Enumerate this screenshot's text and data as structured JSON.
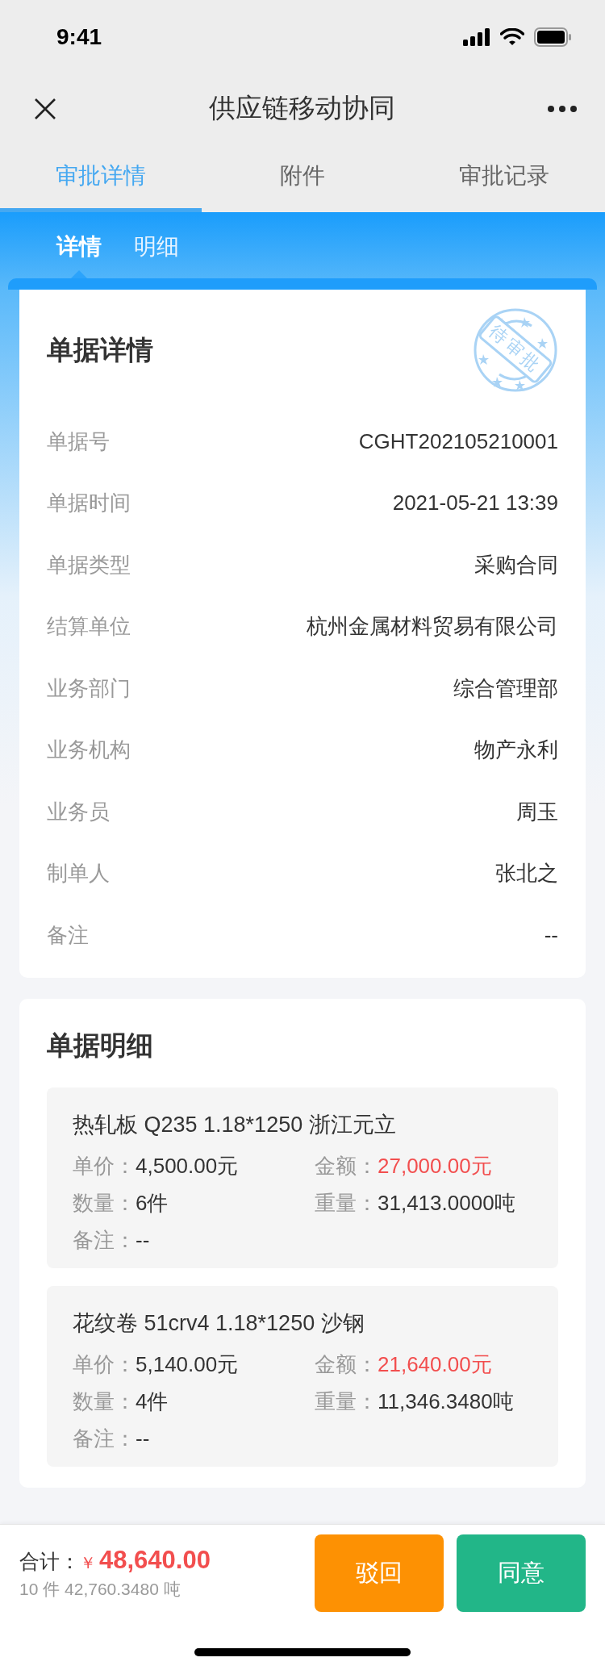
{
  "status_bar": {
    "time": "9:41"
  },
  "nav": {
    "title": "供应链移动协同"
  },
  "tabs": [
    {
      "label": "审批详情",
      "selected": true
    },
    {
      "label": "附件",
      "selected": false
    },
    {
      "label": "审批记录",
      "selected": false
    }
  ],
  "sub_tabs": [
    {
      "label": "详情",
      "selected": true
    },
    {
      "label": "明细",
      "selected": false
    }
  ],
  "detail": {
    "title": "单据详情",
    "stamp": "待审批",
    "fields": [
      {
        "label": "单据号",
        "value": "CGHT202105210001"
      },
      {
        "label": "单据时间",
        "value": "2021-05-21 13:39"
      },
      {
        "label": "单据类型",
        "value": "采购合同"
      },
      {
        "label": "结算单位",
        "value": "杭州金属材料贸易有限公司"
      },
      {
        "label": "业务部门",
        "value": "综合管理部"
      },
      {
        "label": "业务机构",
        "value": "物产永利"
      },
      {
        "label": "业务员",
        "value": "周玉"
      },
      {
        "label": "制单人",
        "value": "张北之"
      },
      {
        "label": "备注",
        "value": "--"
      }
    ]
  },
  "lines": {
    "title": "单据明细",
    "items": [
      {
        "name": "热轧板 Q235 1.18*1250 浙江元立",
        "price_label": "单价：",
        "price": "4,500.00元",
        "amount_label": "金额：",
        "amount": "27,000.00元",
        "qty_label": "数量：",
        "qty": "6件",
        "weight_label": "重量：",
        "weight": "31,413.0000吨",
        "note_label": "备注：",
        "note": "--"
      },
      {
        "name": "花纹卷 51crv4 1.18*1250 沙钢",
        "price_label": "单价：",
        "price": "5,140.00元",
        "amount_label": "金额：",
        "amount": "21,640.00元",
        "qty_label": "数量：",
        "qty": "4件",
        "weight_label": "重量：",
        "weight": "11,346.3480吨",
        "note_label": "备注：",
        "note": "--"
      }
    ]
  },
  "footer": {
    "total_label": "合计：",
    "currency": "￥",
    "total": "48,640.00",
    "summary": "10 件 42,760.3480 吨",
    "buttons": [
      {
        "label": "驳回",
        "kind": "reject"
      },
      {
        "label": "同意",
        "kind": "approve"
      }
    ]
  }
}
